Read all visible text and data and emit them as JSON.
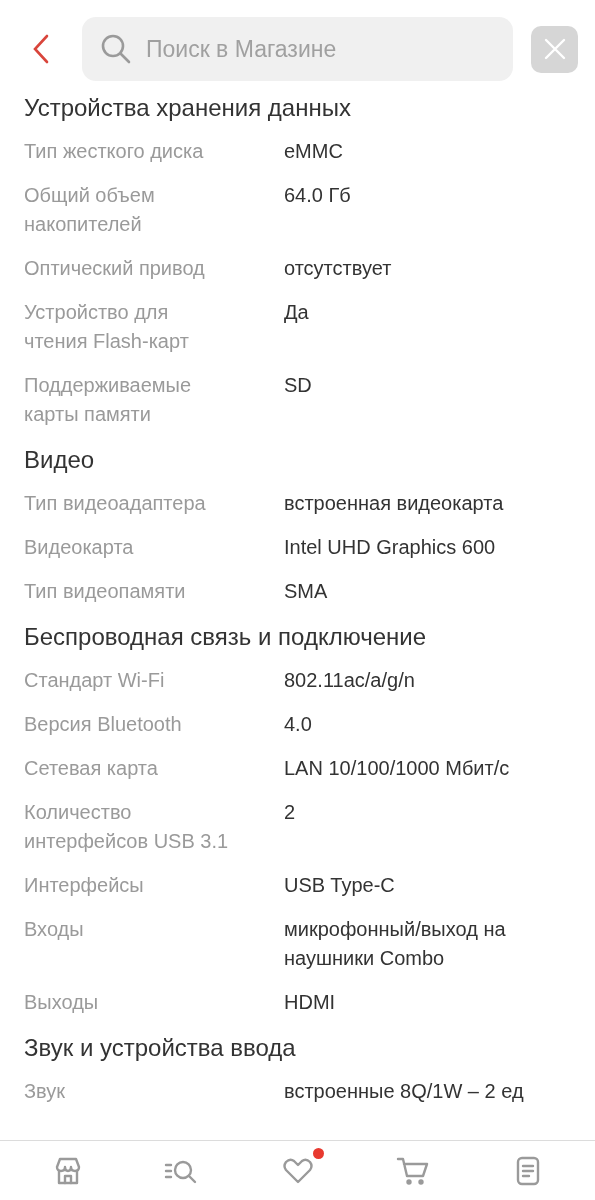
{
  "header": {
    "search": {
      "placeholder": "Поиск в Магазине"
    }
  },
  "sections": [
    {
      "title": "Устройства хранения данных",
      "rows": [
        {
          "label": "Тип жесткого диска",
          "value": "eMMC"
        },
        {
          "label": "Общий объем накопителей",
          "value": "64.0 Гб"
        },
        {
          "label": "Оптический привод",
          "value": "отсутствует"
        },
        {
          "label": "Устройство для чтения Flash-карт",
          "value": "Да"
        },
        {
          "label": "Поддерживаемые карты памяти",
          "value": "SD"
        }
      ]
    },
    {
      "title": "Видео",
      "rows": [
        {
          "label": "Тип видеоадаптера",
          "value": "встроенная видеокарта"
        },
        {
          "label": "Видеокарта",
          "value": "Intel UHD Graphics 600"
        },
        {
          "label": "Тип видеопамяти",
          "value": "SMA"
        }
      ]
    },
    {
      "title": "Беспроводная связь и подключение",
      "rows": [
        {
          "label": "Стандарт Wi-Fi",
          "value": "802.11ac/a/g/n"
        },
        {
          "label": "Версия Bluetooth",
          "value": "4.0"
        },
        {
          "label": "Сетевая карта",
          "value": "LAN 10/100/1000 Мбит/с"
        },
        {
          "label": "Количество интерфейсов USB 3.1",
          "value": "2"
        },
        {
          "label": "Интерфейсы",
          "value": "USB Type-C"
        },
        {
          "label": "Входы",
          "value": "микрофонный/выход на наушники Combo"
        },
        {
          "label": "Выходы",
          "value": "HDMI"
        }
      ]
    },
    {
      "title": "Звук и устройства ввода",
      "rows": [
        {
          "label": "Звук",
          "value": "встроенные 8Q/1W – 2 ед"
        }
      ]
    }
  ],
  "bottom_nav": [
    {
      "kind": "shop",
      "badge": false
    },
    {
      "kind": "catalog",
      "badge": false
    },
    {
      "kind": "favorites",
      "badge": true
    },
    {
      "kind": "cart",
      "badge": false
    },
    {
      "kind": "orders",
      "badge": false
    }
  ]
}
